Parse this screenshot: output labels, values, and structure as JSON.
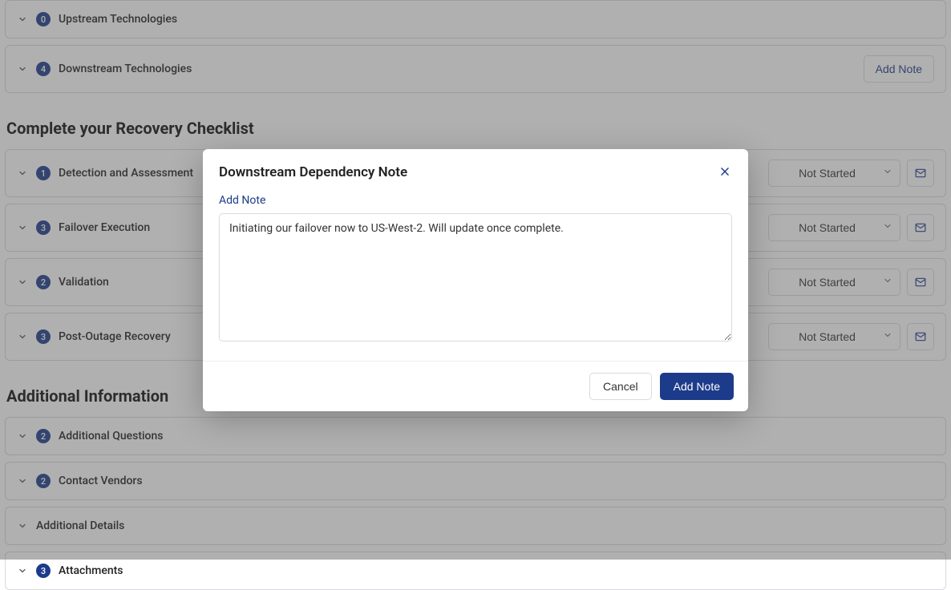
{
  "dependency_panels": [
    {
      "count": 0,
      "title": "Upstream Technologies",
      "has_add_note": false
    },
    {
      "count": 4,
      "title": "Downstream Technologies",
      "has_add_note": true,
      "add_note_label": "Add Note"
    }
  ],
  "checklist_heading": "Complete your Recovery Checklist",
  "checklist_items": [
    {
      "count": 1,
      "title": "Detection and Assessment",
      "status": "Not Started"
    },
    {
      "count": 3,
      "title": "Failover Execution",
      "status": "Not Started"
    },
    {
      "count": 2,
      "title": "Validation",
      "status": "Not Started"
    },
    {
      "count": 3,
      "title": "Post-Outage Recovery",
      "status": "Not Started"
    }
  ],
  "additional_heading": "Additional Information",
  "additional_items": [
    {
      "count": 2,
      "title": "Additional Questions",
      "show_badge": true
    },
    {
      "count": 2,
      "title": "Contact Vendors",
      "show_badge": true
    },
    {
      "count": null,
      "title": "Additional Details",
      "show_badge": false
    },
    {
      "count": 3,
      "title": "Attachments",
      "show_badge": true
    }
  ],
  "modal": {
    "title": "Downstream Dependency Note",
    "label": "Add Note",
    "value": "Initiating our failover now to US-West-2. Will update once complete.",
    "cancel_label": "Cancel",
    "submit_label": "Add Note"
  }
}
